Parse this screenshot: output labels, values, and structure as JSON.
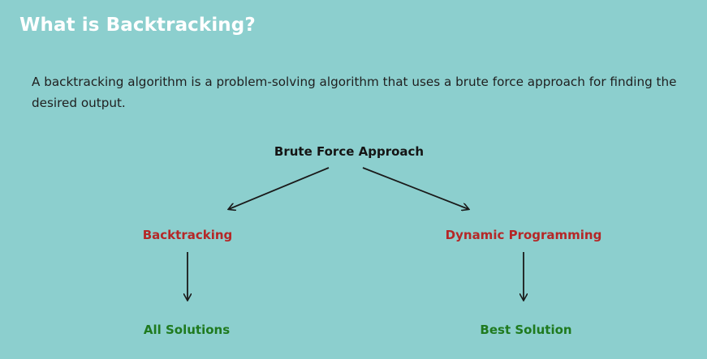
{
  "slide": {
    "title": "What is Backtracking?",
    "description": "A backtracking algorithm is a problem-solving algorithm that uses a brute force approach for finding the desired output."
  },
  "diagram": {
    "root": "Brute Force Approach",
    "branches": [
      {
        "label": "Backtracking",
        "leaf": "All Solutions"
      },
      {
        "label": "Dynamic Programming",
        "leaf": "Best Solution"
      }
    ]
  },
  "colors": {
    "background": "#8ccfce",
    "title": "#ffffff",
    "branch": "#b52727",
    "leaf": "#1f7a1f",
    "arrow": "#1a1a1a"
  }
}
